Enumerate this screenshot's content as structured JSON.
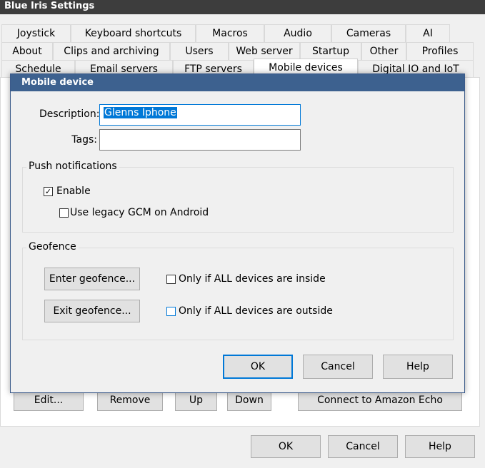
{
  "window": {
    "title": "Blue Iris Settings"
  },
  "tabs": {
    "row1": [
      "Joystick",
      "Keyboard shortcuts",
      "Macros",
      "Audio",
      "Cameras",
      "AI"
    ],
    "row2": [
      "About",
      "Clips and archiving",
      "Users",
      "Web server",
      "Startup",
      "Other",
      "Profiles"
    ],
    "row3": [
      "Schedule",
      "Email servers",
      "FTP servers",
      "Mobile devices",
      "Digital IO and IoT"
    ],
    "active": "Mobile devices"
  },
  "panel": {
    "buttons": {
      "edit": "Edit...",
      "remove": "Remove",
      "up": "Up",
      "down": "Down",
      "echo": "Connect to Amazon Echo"
    }
  },
  "footer": {
    "ok": "OK",
    "cancel": "Cancel",
    "help": "Help"
  },
  "dialog": {
    "title": "Mobile device",
    "description_label": "Description:",
    "description_value": "Glenns Iphone",
    "tags_label": "Tags:",
    "tags_value": "",
    "push": {
      "title": "Push notifications",
      "enable_label": "Enable",
      "enable_checked": true,
      "legacy_label": "Use legacy GCM on Android",
      "legacy_checked": false
    },
    "geofence": {
      "title": "Geofence",
      "enter_button": "Enter geofence...",
      "exit_button": "Exit geofence...",
      "inside_label": "Only if ALL devices are inside",
      "inside_checked": false,
      "outside_label": "Only if ALL devices are outside",
      "outside_checked": false
    },
    "ok": "OK",
    "cancel": "Cancel",
    "help": "Help"
  }
}
